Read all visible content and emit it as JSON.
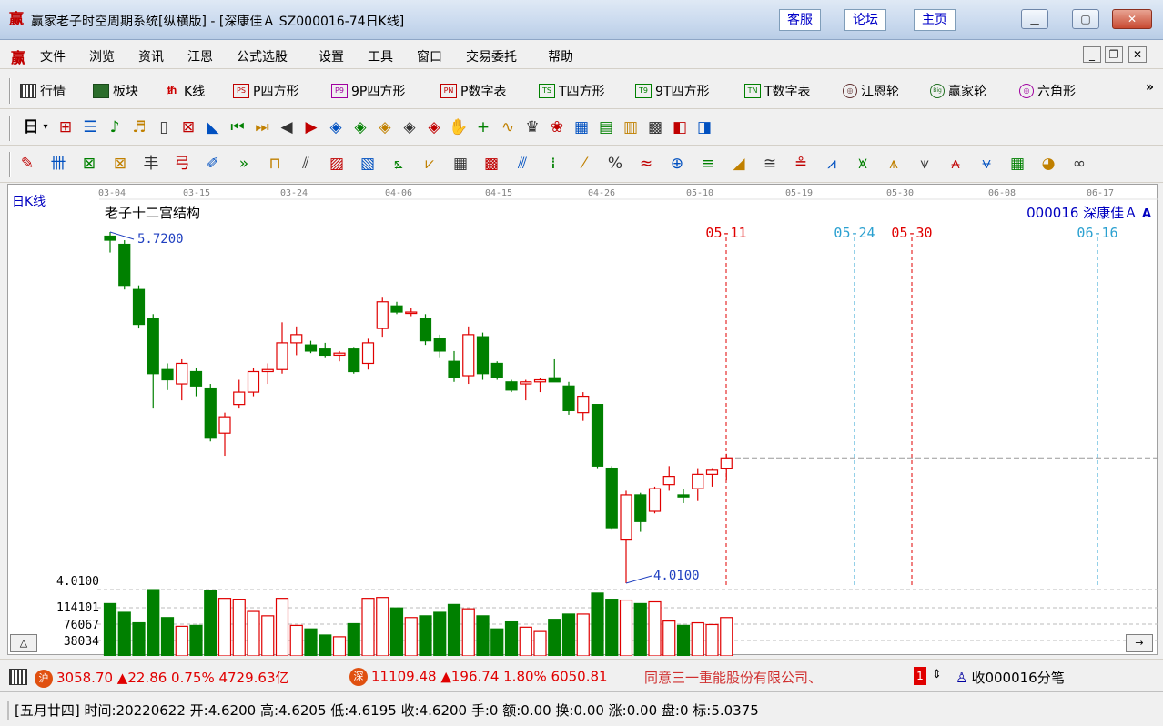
{
  "window": {
    "title": "赢家老子时空周期系统[纵横版] - [深康佳Ａ  SZ000016-74日K线]",
    "links": [
      "客服",
      "论坛",
      "主页"
    ],
    "app_icon": "赢"
  },
  "menu": {
    "items": [
      "文件",
      "浏览",
      "资讯",
      "江恩",
      "公式选股",
      "设置",
      "工具",
      "窗口",
      "交易委托",
      "帮助"
    ]
  },
  "toolbar1": {
    "items": [
      {
        "label": "行情",
        "icon": "grid-icon"
      },
      {
        "label": "板块",
        "icon": "board-icon"
      },
      {
        "label": "K线",
        "icon": "kline-icon"
      },
      {
        "label": "P四方形",
        "icon": "ps-icon",
        "badge": "PS"
      },
      {
        "label": "9P四方形",
        "icon": "p9-icon",
        "badge": "P9"
      },
      {
        "label": "P数字表",
        "icon": "pn-icon",
        "badge": "PN"
      },
      {
        "label": "T四方形",
        "icon": "ts-icon",
        "badge": "TS"
      },
      {
        "label": "9T四方形",
        "icon": "t9-icon",
        "badge": "T9"
      },
      {
        "label": "T数字表",
        "icon": "tn-icon",
        "badge": "TN"
      },
      {
        "label": "江恩轮",
        "icon": "gann-wheel-icon",
        "badge": "◎"
      },
      {
        "label": "赢家轮",
        "icon": "winner-wheel-icon",
        "badge": "Big"
      },
      {
        "label": "六角形",
        "icon": "hexagon-icon",
        "badge": "◎"
      }
    ],
    "more": "»"
  },
  "toolbar2": {
    "period_label": "日",
    "arrow": "▾",
    "glyphs": [
      "⊞",
      "☰",
      "♪",
      "♬",
      "▯",
      "⊠",
      "◣",
      "⏮",
      "⏭",
      "◀",
      "▶",
      "◈",
      "◈",
      "◈",
      "◈",
      "◈",
      "✋",
      "+",
      "∿",
      "♛",
      "❀",
      "▦",
      "▤",
      "▥",
      "▩",
      "◧",
      "◨"
    ]
  },
  "toolbar3": {
    "glyphs": [
      "✎",
      "卌",
      "⊠",
      "⊠",
      "丰",
      "弓",
      "✐",
      "»",
      "⊓",
      "⫽",
      "▨",
      "▧",
      "⦩",
      "⩗",
      "▦",
      "▩",
      "⫻",
      "⁞",
      "⁄",
      "%",
      "≈",
      "⊕",
      "≡",
      "◢",
      "≅",
      "≗",
      "⩘",
      "⩙",
      "⩚",
      "⩛",
      "⩜",
      "⩝",
      "▦",
      "◕",
      "∞"
    ]
  },
  "chart_data": {
    "type": "candlestick",
    "period_label": "日K线",
    "title": "老子十二宫结构",
    "stock": "000016  深康佳Ａ",
    "date_ticks": [
      "03-04",
      "03-15",
      "03-24",
      "04-06",
      "04-15",
      "04-26",
      "05-10",
      "05-19",
      "05-30",
      "06-08",
      "06-17"
    ],
    "high_label": "5.7200",
    "low_label": "4.0100",
    "y_range": [
      4.01,
      5.72
    ],
    "marker_dates": [
      {
        "label": "05-11",
        "color": "#e00000"
      },
      {
        "label": "05-24",
        "color": "#2aa0d0"
      },
      {
        "label": "05-30",
        "color": "#e00000"
      },
      {
        "label": "06-16",
        "color": "#2aa0d0"
      }
    ],
    "candles": [
      {
        "o": 5.7,
        "h": 5.72,
        "l": 5.62,
        "c": 5.68
      },
      {
        "o": 5.66,
        "h": 5.68,
        "l": 5.44,
        "c": 5.46
      },
      {
        "o": 5.44,
        "h": 5.46,
        "l": 5.25,
        "c": 5.27
      },
      {
        "o": 5.3,
        "h": 5.32,
        "l": 4.86,
        "c": 5.03
      },
      {
        "o": 5.05,
        "h": 5.08,
        "l": 4.95,
        "c": 5.0
      },
      {
        "o": 4.98,
        "h": 5.1,
        "l": 4.9,
        "c": 5.08
      },
      {
        "o": 5.04,
        "h": 5.06,
        "l": 4.92,
        "c": 4.97
      },
      {
        "o": 4.96,
        "h": 4.98,
        "l": 4.7,
        "c": 4.72
      },
      {
        "o": 4.74,
        "h": 4.84,
        "l": 4.63,
        "c": 4.82
      },
      {
        "o": 4.88,
        "h": 5.0,
        "l": 4.86,
        "c": 4.94
      },
      {
        "o": 4.94,
        "h": 5.06,
        "l": 4.92,
        "c": 5.04
      },
      {
        "o": 5.04,
        "h": 5.08,
        "l": 4.98,
        "c": 5.05
      },
      {
        "o": 5.05,
        "h": 5.28,
        "l": 5.03,
        "c": 5.18
      },
      {
        "o": 5.18,
        "h": 5.26,
        "l": 5.12,
        "c": 5.22
      },
      {
        "o": 5.17,
        "h": 5.19,
        "l": 5.13,
        "c": 5.14
      },
      {
        "o": 5.15,
        "h": 5.18,
        "l": 5.11,
        "c": 5.12
      },
      {
        "o": 5.12,
        "h": 5.14,
        "l": 5.09,
        "c": 5.13
      },
      {
        "o": 5.15,
        "h": 5.16,
        "l": 5.03,
        "c": 5.04
      },
      {
        "o": 5.08,
        "h": 5.2,
        "l": 5.05,
        "c": 5.18
      },
      {
        "o": 5.25,
        "h": 5.4,
        "l": 5.21,
        "c": 5.38
      },
      {
        "o": 5.36,
        "h": 5.38,
        "l": 5.32,
        "c": 5.33
      },
      {
        "o": 5.33,
        "h": 5.35,
        "l": 5.31,
        "c": 5.33
      },
      {
        "o": 5.3,
        "h": 5.32,
        "l": 5.17,
        "c": 5.19
      },
      {
        "o": 5.2,
        "h": 5.22,
        "l": 5.11,
        "c": 5.14
      },
      {
        "o": 5.09,
        "h": 5.14,
        "l": 4.99,
        "c": 5.01
      },
      {
        "o": 5.02,
        "h": 5.26,
        "l": 4.98,
        "c": 5.22
      },
      {
        "o": 5.21,
        "h": 5.23,
        "l": 5.0,
        "c": 5.03
      },
      {
        "o": 5.08,
        "h": 5.09,
        "l": 5.0,
        "c": 5.01
      },
      {
        "o": 4.99,
        "h": 5.0,
        "l": 4.94,
        "c": 4.95
      },
      {
        "o": 4.98,
        "h": 5.0,
        "l": 4.9,
        "c": 4.99
      },
      {
        "o": 4.99,
        "h": 5.01,
        "l": 4.94,
        "c": 5.0
      },
      {
        "o": 5.01,
        "h": 5.1,
        "l": 4.99,
        "c": 4.99
      },
      {
        "o": 4.97,
        "h": 4.99,
        "l": 4.83,
        "c": 4.85
      },
      {
        "o": 4.84,
        "h": 4.94,
        "l": 4.8,
        "c": 4.92
      },
      {
        "o": 4.88,
        "h": 4.88,
        "l": 4.57,
        "c": 4.58
      },
      {
        "o": 4.57,
        "h": 4.58,
        "l": 4.27,
        "c": 4.28
      },
      {
        "o": 4.22,
        "h": 4.46,
        "l": 4.01,
        "c": 4.44
      },
      {
        "o": 4.44,
        "h": 4.45,
        "l": 4.26,
        "c": 4.31
      },
      {
        "o": 4.36,
        "h": 4.48,
        "l": 4.35,
        "c": 4.47
      },
      {
        "o": 4.49,
        "h": 4.58,
        "l": 4.46,
        "c": 4.53
      },
      {
        "o": 4.44,
        "h": 4.47,
        "l": 4.4,
        "c": 4.43
      },
      {
        "o": 4.47,
        "h": 4.57,
        "l": 4.41,
        "c": 4.54
      },
      {
        "o": 4.54,
        "h": 4.57,
        "l": 4.48,
        "c": 4.56
      },
      {
        "o": 4.57,
        "h": 4.64,
        "l": 4.51,
        "c": 4.62
      }
    ],
    "volume_labels": [
      "4.0100",
      "114101",
      "76067",
      "38034"
    ],
    "volume_max": 152135,
    "volumes": [
      120000,
      100000,
      76000,
      152000,
      88000,
      68000,
      70000,
      150000,
      132000,
      130000,
      102000,
      92000,
      132000,
      70000,
      62000,
      48000,
      44000,
      74000,
      132000,
      134000,
      110000,
      88000,
      92000,
      100000,
      118000,
      108000,
      92000,
      62000,
      78000,
      66000,
      56000,
      84000,
      96000,
      96000,
      144000,
      130000,
      128000,
      120000,
      124000,
      80000,
      70000,
      76000,
      72000,
      88000
    ],
    "last_price_line": 4.62
  },
  "status1": {
    "sh_icon": "沪",
    "sh_text": "3058.70 ▲22.86 0.75% 4729.63亿",
    "sz_icon": "深",
    "sz_text": "11109.48 ▲196.74 1.80% 6050.81",
    "ticker": "同意三一重能股份有限公司、",
    "ticker_num": "1",
    "spinner": "⇕",
    "right_text": "收000016分笔"
  },
  "status2": {
    "text": "[五月廿四] 时间:20220622 开:4.6200 高:4.6205 低:4.6195 收:4.6200 手:0 额:0.00 换:0.00 涨:0.00 盘:0 标:5.0375"
  },
  "colors": {
    "up": "#e00000",
    "down": "#008000",
    "accent": "#0000c0"
  }
}
